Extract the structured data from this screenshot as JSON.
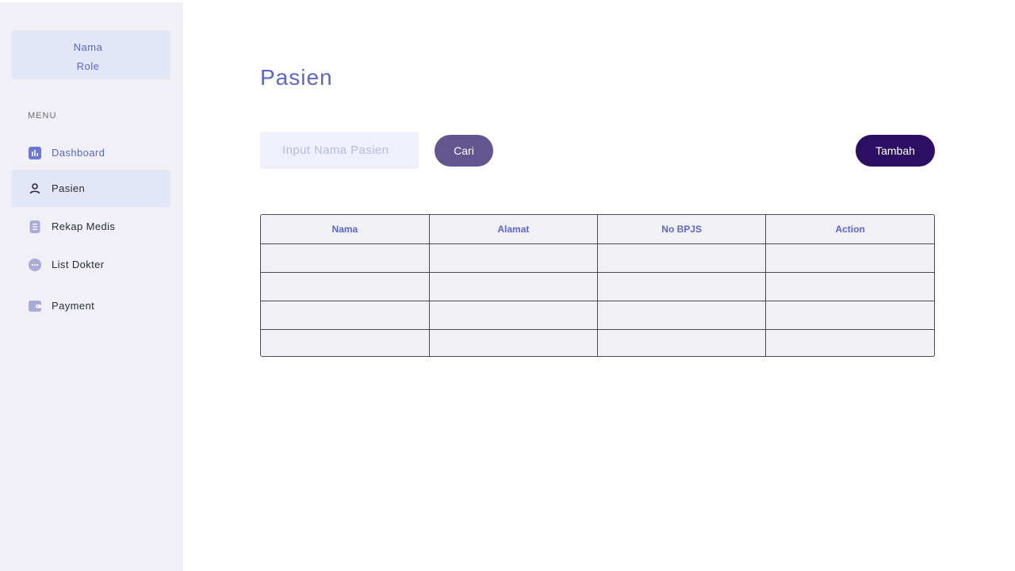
{
  "sidebar": {
    "profile": {
      "name": "Nama",
      "role": "Role"
    },
    "menu_label": "MENU",
    "items": [
      {
        "label": "Dashboard",
        "icon": "dashboard-icon",
        "state": "accent"
      },
      {
        "label": "Pasien",
        "icon": "person-icon",
        "state": "active"
      },
      {
        "label": "Rekap Medis",
        "icon": "document-icon",
        "state": "normal"
      },
      {
        "label": "List Dokter",
        "icon": "chat-icon",
        "state": "normal"
      },
      {
        "label": "Payment",
        "icon": "wallet-icon",
        "state": "normal"
      }
    ]
  },
  "main": {
    "title": "Pasien",
    "search": {
      "placeholder": "Input Nama Pasien",
      "value": ""
    },
    "buttons": {
      "search_label": "Cari",
      "add_label": "Tambah"
    },
    "table": {
      "columns": [
        "Nama",
        "Alamat",
        "No BPJS",
        "Action"
      ],
      "rows": [
        [
          "",
          "",
          "",
          ""
        ],
        [
          "",
          "",
          "",
          ""
        ],
        [
          "",
          "",
          "",
          ""
        ],
        [
          "",
          "",
          "",
          ""
        ]
      ]
    }
  },
  "colors": {
    "accent": "#5a67c8",
    "sidebar_bg": "#f0f0f6",
    "active_bg": "#e3e6f6",
    "search_button": "#625590",
    "add_button": "#2b0f63",
    "table_bg": "#f0f0f5"
  }
}
